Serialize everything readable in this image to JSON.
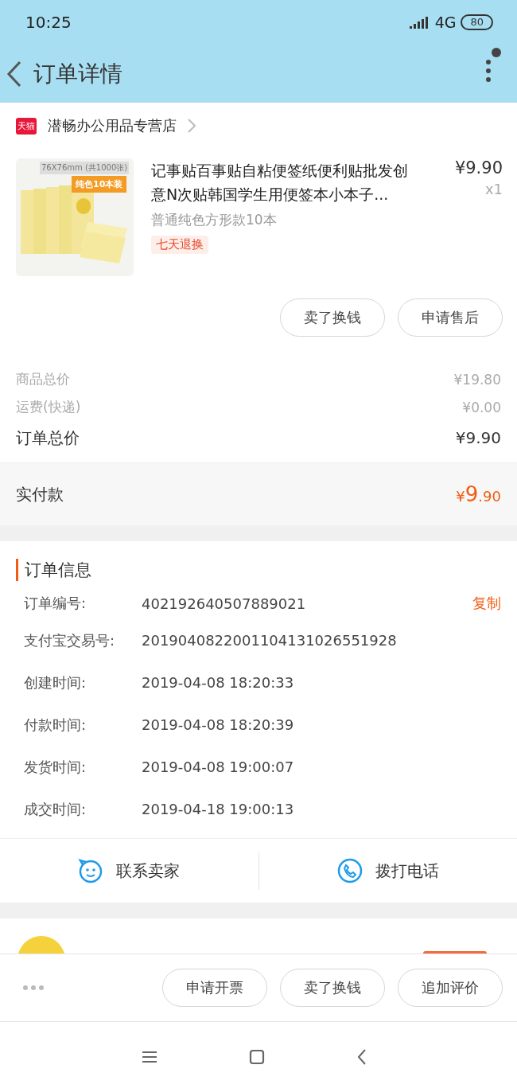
{
  "status_bar": {
    "time": "10:25",
    "network": "4G",
    "battery": "80"
  },
  "header": {
    "title": "订单详情",
    "notification_dot": true
  },
  "store": {
    "name": "潜畅办公用品专营店",
    "badge": "天猫"
  },
  "product": {
    "title": "记事贴百事贴自粘便签纸便利贴批发创意N次贴韩国学生用便签本小本子...",
    "price": "¥9.90",
    "quantity": "x1",
    "variant": "普通纯色方形款10本",
    "tag": "七天退换",
    "image_caption": "76X76mm (共1000张)",
    "image_banner": "纯色10本装"
  },
  "item_actions": [
    "卖了换钱",
    "申请售后"
  ],
  "summary": [
    {
      "label": "商品总价",
      "value": "¥19.80",
      "kind": "minor"
    },
    {
      "label": "运费(快递)",
      "value": "¥0.00",
      "kind": "minor"
    },
    {
      "label": "订单总价",
      "value": "¥9.90",
      "kind": "major"
    }
  ],
  "paid": {
    "label": "实付款",
    "currency": "¥",
    "integer": "9",
    "decimal": ".90"
  },
  "order_info": {
    "title": "订单信息",
    "rows": [
      {
        "label": "订单编号:",
        "value": "402192640507889021",
        "action": "复制"
      },
      {
        "label": "支付宝交易号:",
        "value": "2019040822001104131026551928"
      },
      {
        "label": "创建时间:",
        "value": "2019-04-08 18:20:33"
      },
      {
        "label": "付款时间:",
        "value": "2019-04-08 18:20:39"
      },
      {
        "label": "发货时间:",
        "value": "2019-04-08 19:00:07"
      },
      {
        "label": "成交时间:",
        "value": "2019-04-18 19:00:13"
      }
    ]
  },
  "contact": [
    {
      "label": "联系卖家",
      "kind": "chat"
    },
    {
      "label": "拨打电话",
      "kind": "phone"
    }
  ],
  "bottom_actions": [
    "申请开票",
    "卖了换钱",
    "追加评价"
  ]
}
